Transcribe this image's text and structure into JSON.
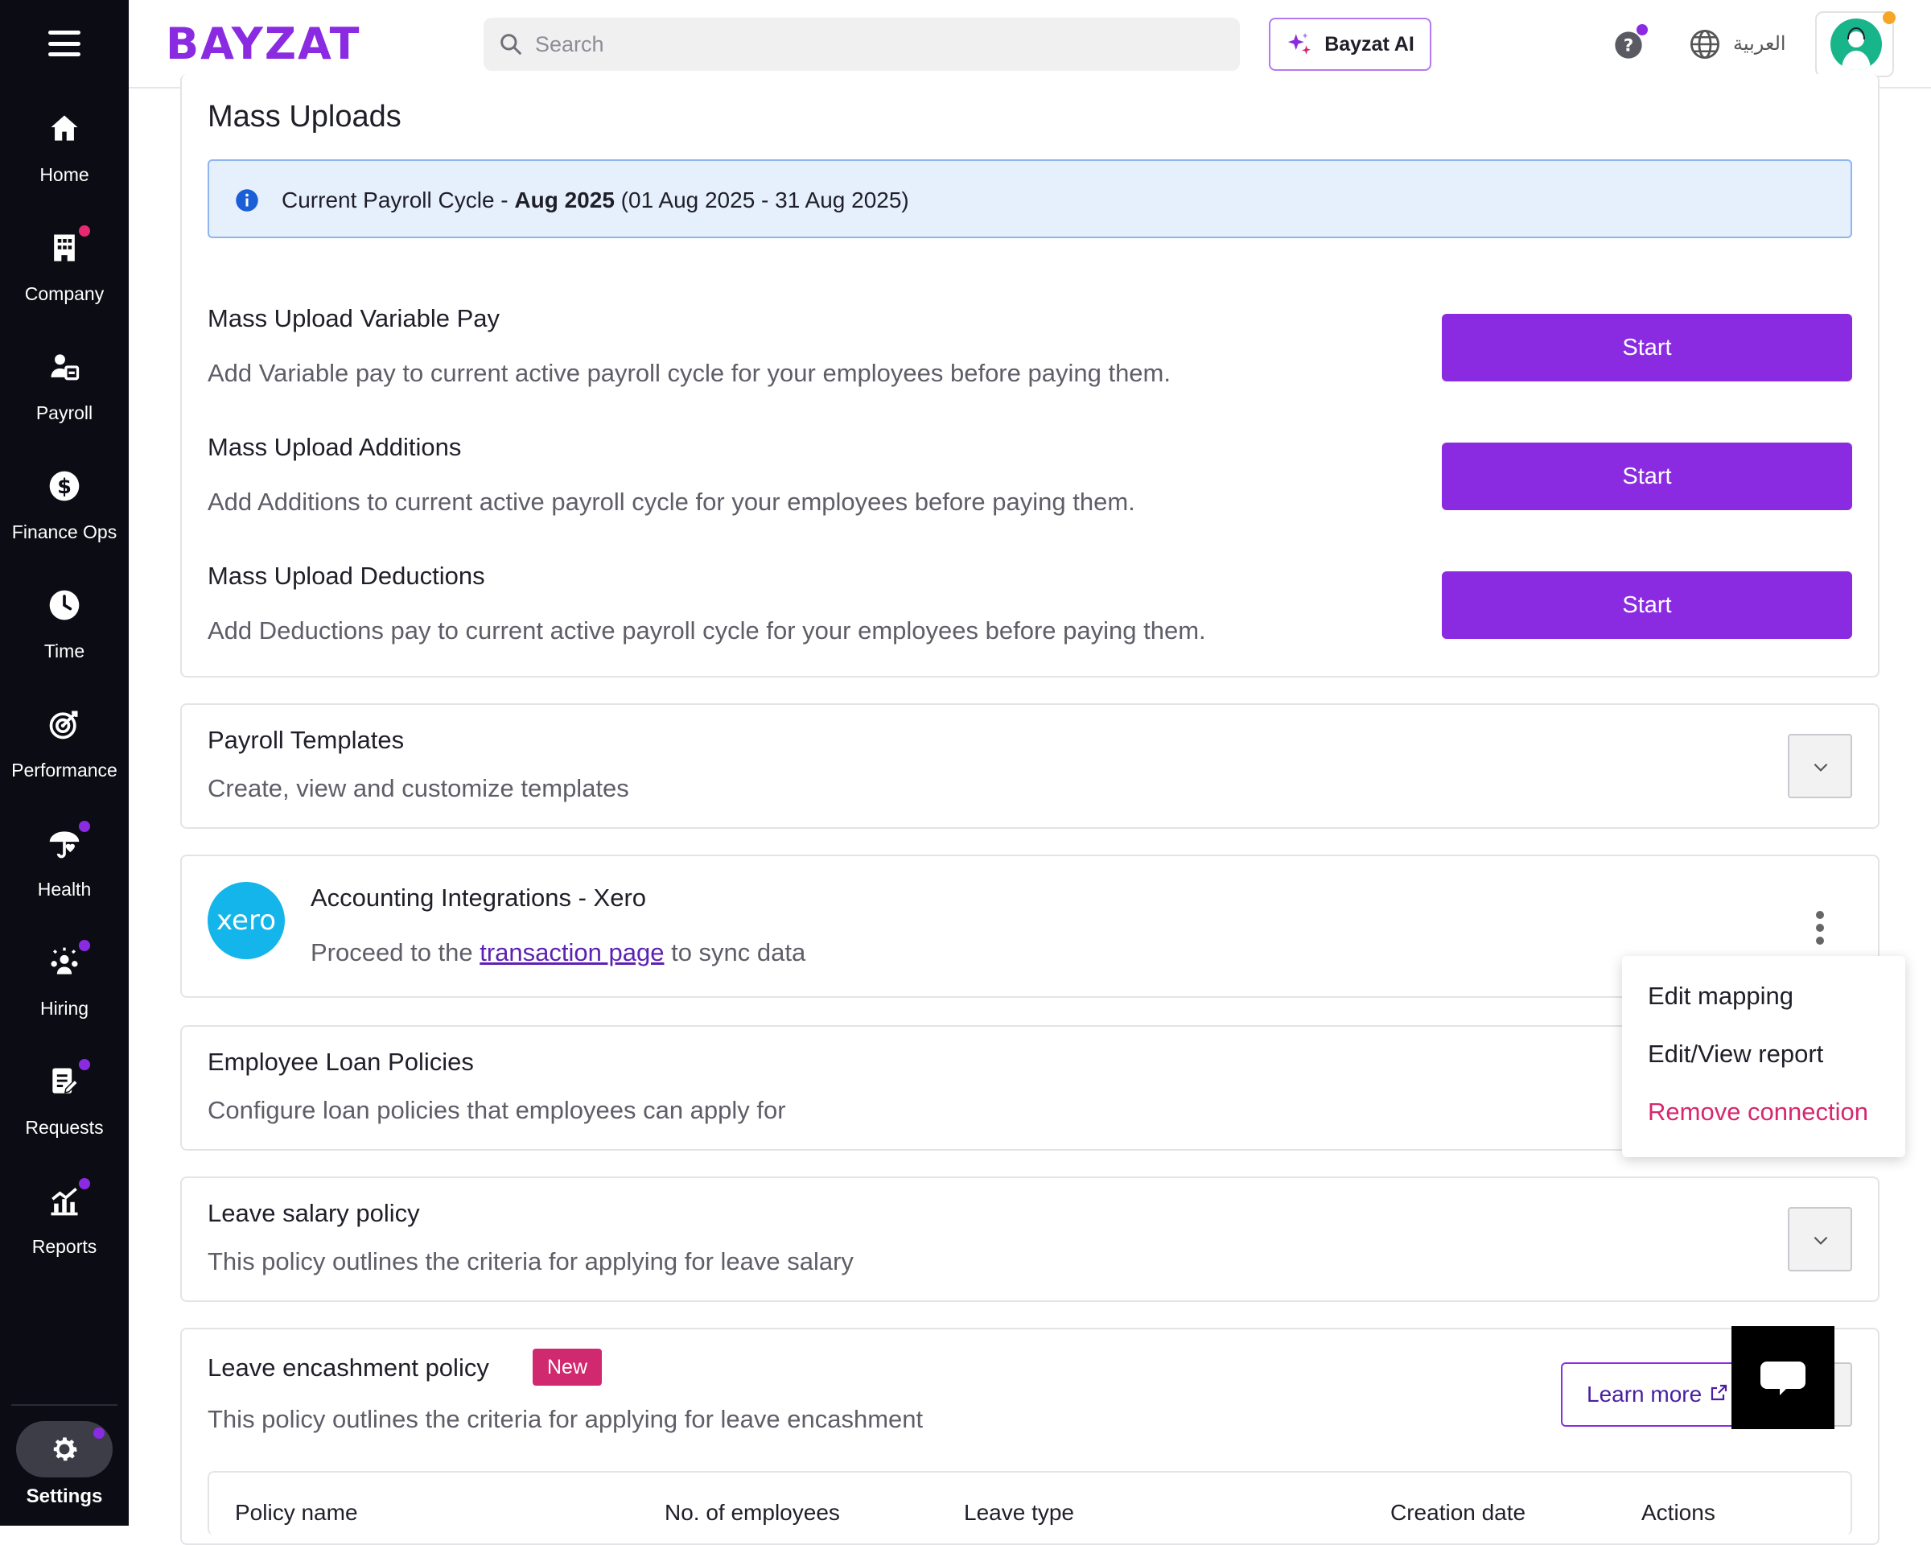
{
  "sidebar": {
    "items": [
      {
        "label": "Home",
        "icon": "home-icon"
      },
      {
        "label": "Company",
        "icon": "building-icon"
      },
      {
        "label": "Payroll",
        "icon": "payroll-icon"
      },
      {
        "label": "Finance Ops",
        "icon": "dollar-icon"
      },
      {
        "label": "Time",
        "icon": "clock-icon"
      },
      {
        "label": "Performance",
        "icon": "target-icon"
      },
      {
        "label": "Health",
        "icon": "health-icon"
      },
      {
        "label": "Hiring",
        "icon": "hiring-icon"
      },
      {
        "label": "Requests",
        "icon": "requests-icon"
      },
      {
        "label": "Reports",
        "icon": "reports-icon"
      }
    ],
    "settings_label": "Settings",
    "active_item": "Settings"
  },
  "header": {
    "logo_text": "BAYZAT",
    "search_placeholder": "Search",
    "ai_button_label": "Bayzat AI",
    "language_label": "العربية"
  },
  "colors": {
    "brand": "#8a2be2",
    "notification_dot": "#e8286f",
    "purple_dot": "#8a2be2",
    "orange_dot": "#f5a623",
    "danger": "#d6286f",
    "info_banner": "#e6f0fd"
  },
  "mass_uploads": {
    "title": "Mass Uploads",
    "banner": {
      "prefix": "Current Payroll Cycle - ",
      "cycle": "Aug 2025",
      "range": " (01 Aug 2025 - 31 Aug 2025)"
    },
    "items": [
      {
        "title": "Mass Upload Variable Pay",
        "description": "Add Variable pay to current active payroll cycle for your employees before paying them.",
        "button": "Start"
      },
      {
        "title": "Mass Upload Additions",
        "description": "Add Additions to current active payroll cycle for your employees before paying them.",
        "button": "Start"
      },
      {
        "title": "Mass Upload Deductions",
        "description": "Add Deductions pay to current active payroll cycle for your employees before paying them.",
        "button": "Start"
      }
    ]
  },
  "payroll_templates": {
    "title": "Payroll Templates",
    "description": "Create, view and customize templates"
  },
  "xero": {
    "logo_text": "xero",
    "title": "Accounting Integrations - Xero",
    "desc_prefix": "Proceed to the ",
    "link_text": "transaction page",
    "desc_suffix": " to sync data",
    "menu": [
      "Edit mapping",
      "Edit/View report",
      "Remove connection"
    ]
  },
  "loan_policies": {
    "title": "Employee Loan Policies",
    "description": "Configure loan policies that employees can apply for"
  },
  "leave_salary": {
    "title": "Leave salary policy",
    "description": "This policy outlines the criteria for applying for leave salary"
  },
  "leave_encashment": {
    "title": "Leave encashment policy",
    "badge": "New",
    "description": "This policy outlines the criteria for applying for leave encashment",
    "learn_more": "Learn more",
    "table_headers": [
      "Policy name",
      "No. of employees",
      "Leave type",
      "Creation date",
      "Actions"
    ]
  }
}
